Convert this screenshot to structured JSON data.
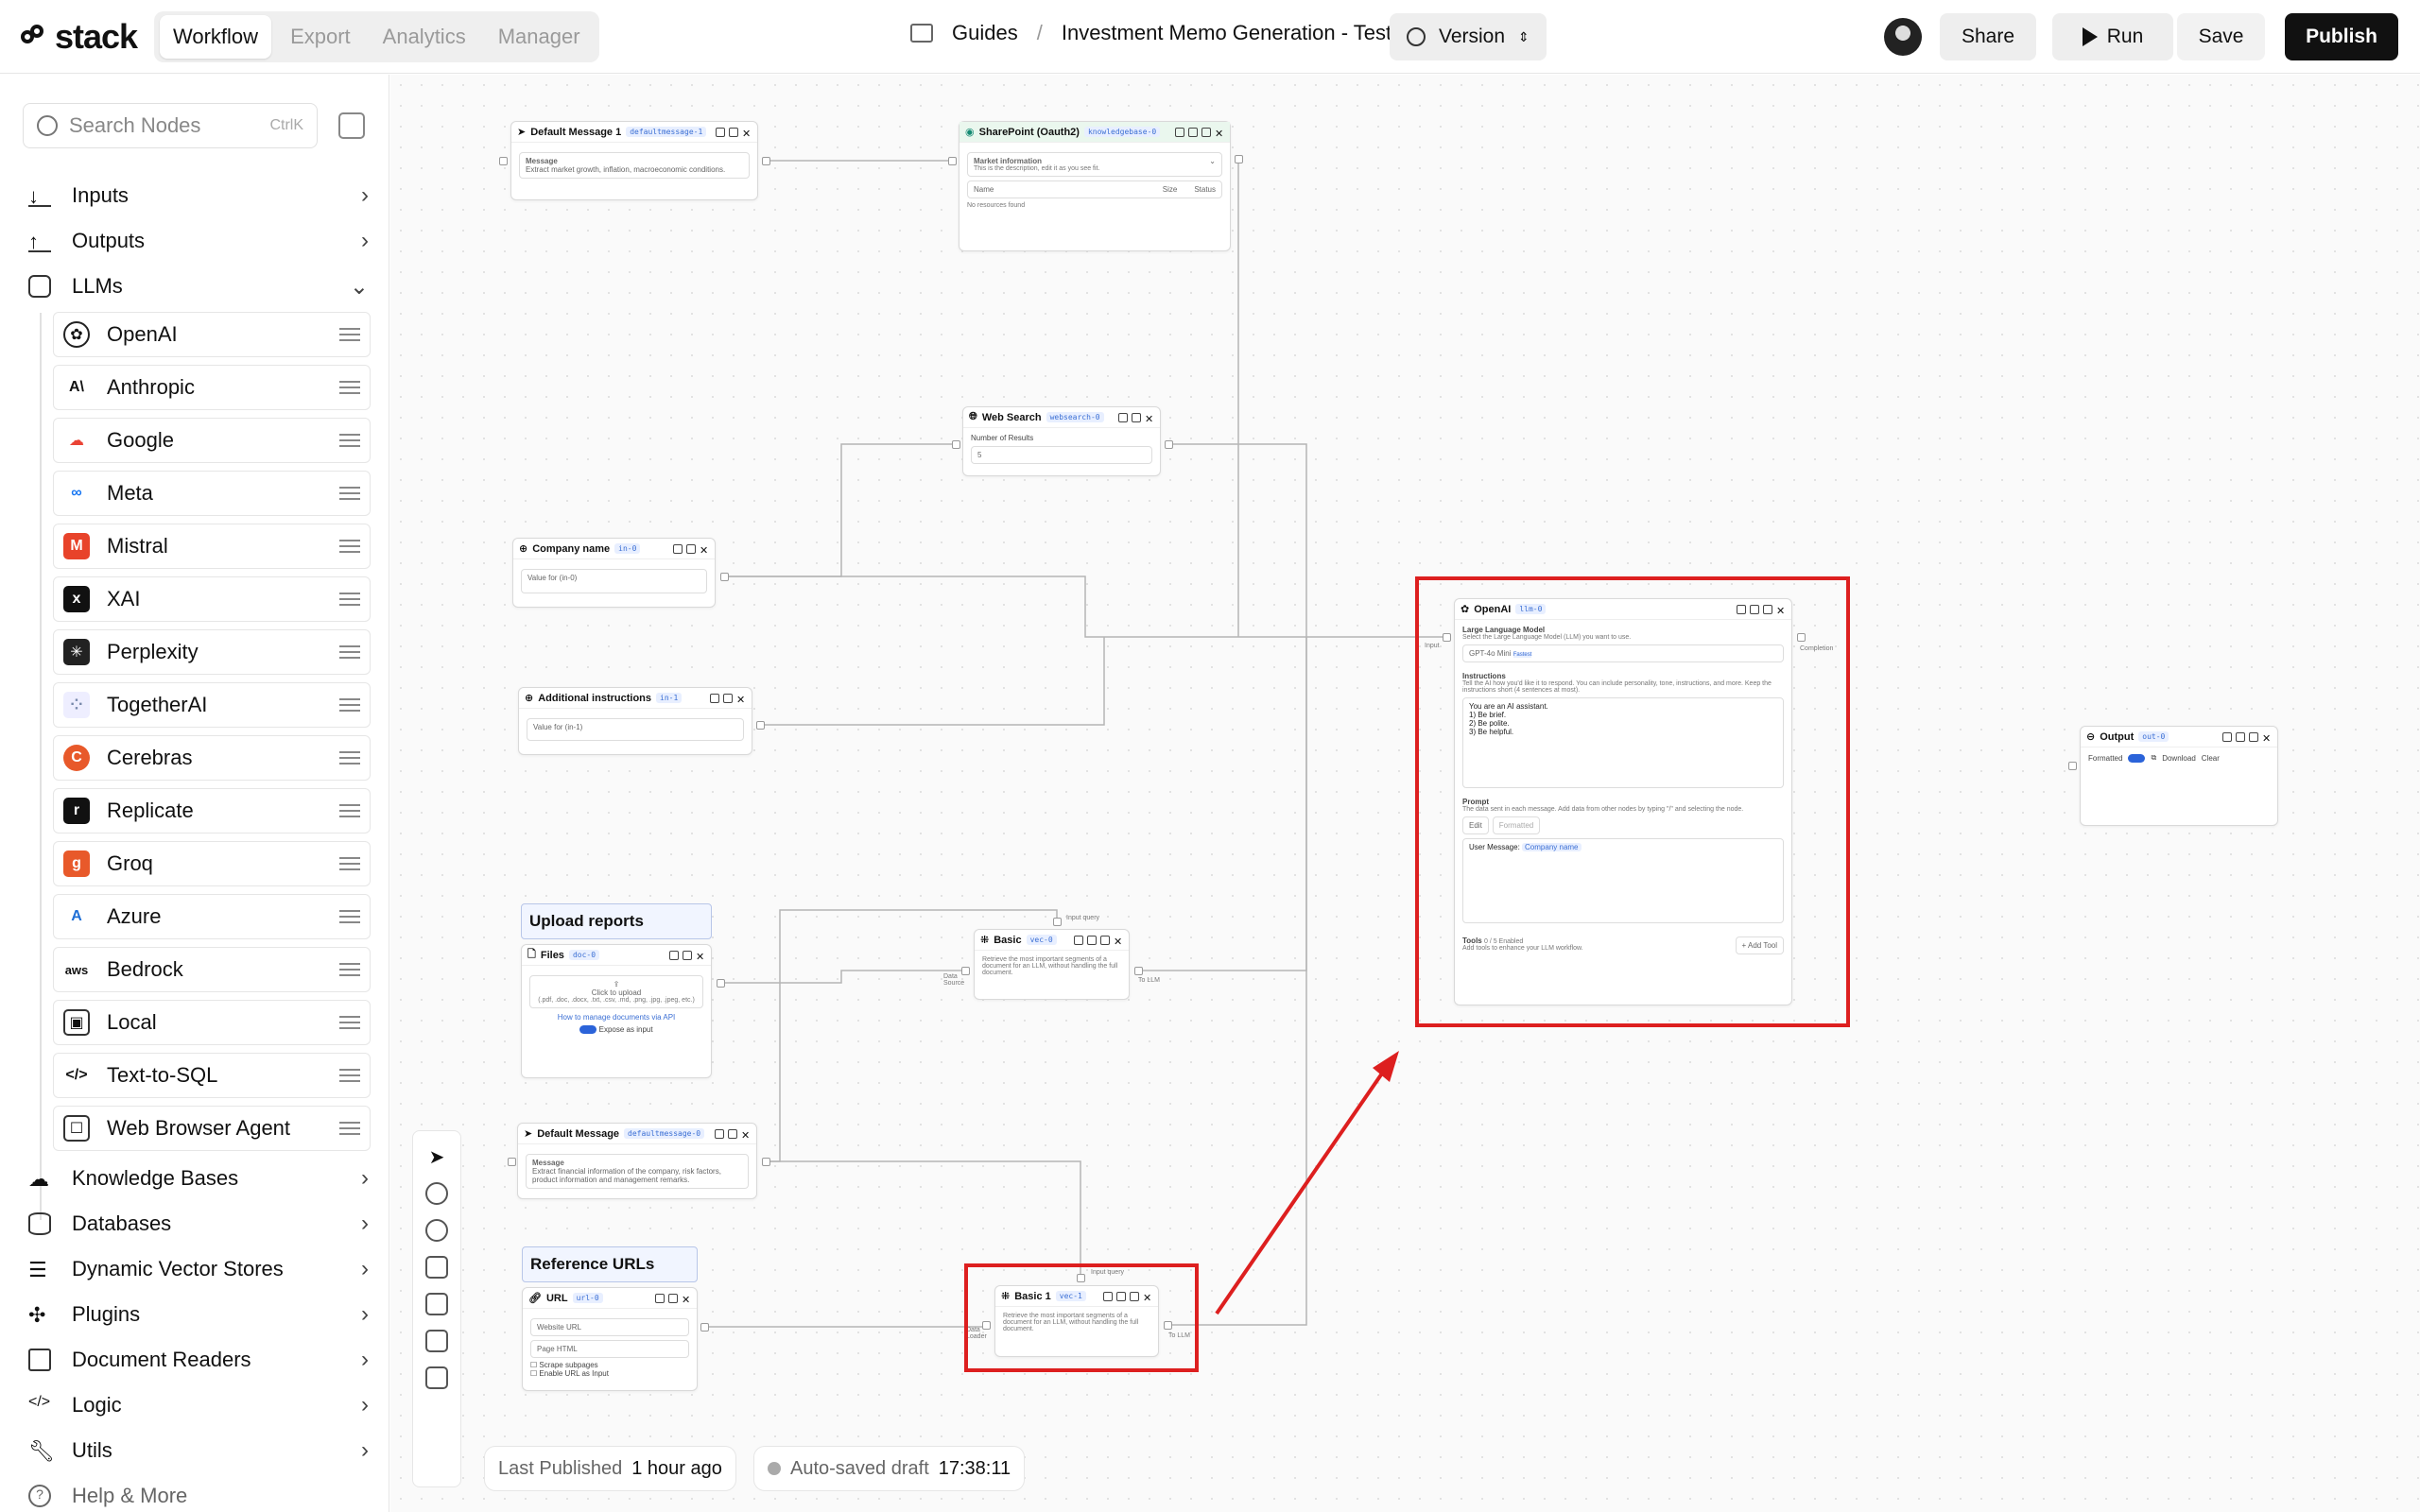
{
  "brand": "stack",
  "tabs": [
    "Workflow",
    "Export",
    "Analytics",
    "Manager"
  ],
  "breadcrumb": {
    "folder": "Guides",
    "page": "Investment Memo Generation - Test"
  },
  "version_label": "Version",
  "header_buttons": {
    "share": "Share",
    "run": "Run",
    "save": "Save",
    "publish": "Publish"
  },
  "sidebar": {
    "search_placeholder": "Search Nodes",
    "search_shortcut": "CtrlK",
    "top_categories": [
      "Inputs",
      "Outputs",
      "LLMs"
    ],
    "llms": [
      "OpenAI",
      "Anthropic",
      "Google",
      "Meta",
      "Mistral",
      "XAI",
      "Perplexity",
      "TogetherAI",
      "Cerebras",
      "Replicate",
      "Groq",
      "Azure",
      "Bedrock",
      "Local",
      "Text-to-SQL",
      "Web Browser Agent"
    ],
    "bottom_categories": [
      "Knowledge Bases",
      "Databases",
      "Dynamic Vector Stores",
      "Plugins",
      "Document Readers",
      "Logic",
      "Utils"
    ],
    "help": "Help & More"
  },
  "nodes": {
    "default_message_1": {
      "title": "Default Message 1",
      "tag": "defaultmessage-1",
      "label": "Message",
      "text": "Extract market growth, inflation, macroeconomic conditions."
    },
    "sharepoint": {
      "title": "SharePoint (Oauth2)",
      "tag": "knowledgebase-0",
      "section": "Market information",
      "desc": "This is the description, edit it as you see fit.",
      "cols": [
        "Name",
        "Size",
        "Status"
      ],
      "empty": "No resources found"
    },
    "web_search": {
      "title": "Web Search",
      "tag": "websearch-0",
      "field": "Number of Results",
      "value": "5"
    },
    "company_name": {
      "title": "Company name",
      "tag": "in-0",
      "placeholder": "Value for (in-0)"
    },
    "additional_instructions": {
      "title": "Additional instructions",
      "tag": "in-1",
      "placeholder": "Value for (in-1)"
    },
    "upload_reports": {
      "label": "Upload reports",
      "title": "Files",
      "tag": "doc-0",
      "upload": "Click to upload",
      "types": "(.pdf, .doc, .docx, .txt, .csv, .md, .png, .jpg, .jpeg, etc.)",
      "link": "How to manage documents via API",
      "toggle": "Expose as input"
    },
    "basic": {
      "title": "Basic",
      "tag": "vec-0",
      "text": "Retrieve the most important segments of a document for an LLM, without handling the full document.",
      "port_top": "Input query",
      "port_left": "Data Source",
      "port_right": "To LLM"
    },
    "default_message": {
      "title": "Default Message",
      "tag": "defaultmessage-0",
      "label": "Message",
      "text": "Extract financial information of the company, risk factors, product information and management remarks."
    },
    "reference_urls": {
      "label": "Reference URLs",
      "title": "URL",
      "tag": "url-0",
      "placeholder": "Website URL",
      "pages": "Page HTML",
      "opt1": "Scrape subpages",
      "opt2": "Enable URL as Input"
    },
    "basic_1": {
      "title": "Basic 1",
      "tag": "vec-1",
      "text": "Retrieve the most important segments of a document for an LLM, without handling the full document.",
      "port_top": "Input query",
      "port_left": "Data Loader",
      "port_right": "To LLM"
    },
    "openai": {
      "title": "OpenAI",
      "tag": "llm-0",
      "model_title": "Large Language Model",
      "model_desc": "Select the Large Language Model (LLM) you want to use.",
      "model": "GPT-4o Mini",
      "model_badge": "Fastest",
      "instr_title": "Instructions",
      "instr_desc": "Tell the AI how you'd like it to respond. You can include personality, tone, instructions, and more. Keep the instructions short (4 sentences at most).",
      "instructions": [
        "You are an AI assistant.",
        "1) Be brief.",
        "2) Be polite.",
        "3) Be helpful."
      ],
      "prompt_title": "Prompt",
      "prompt_desc": "The data sent in each message. Add data from other nodes by typing \"/\" and selecting the node.",
      "prompt_tabs": [
        "Edit",
        "Formatted"
      ],
      "prompt_prefix": "User Message:",
      "prompt_chip": "Company name",
      "tools_title": "Tools",
      "tools_count": "0 / 5 Enabled",
      "tools_desc": "Add tools to enhance your LLM workflow.",
      "add_tool": "+ Add Tool",
      "port_in": "Input",
      "port_out": "Completion"
    },
    "output": {
      "title": "Output",
      "tag": "out-0",
      "mode": "Formatted",
      "download": "Download",
      "clear": "Clear"
    }
  },
  "status": {
    "published_label": "Last Published",
    "published_value": "1 hour ago",
    "draft_label": "Auto-saved draft",
    "draft_value": "17:38:11"
  },
  "colors": {
    "highlight": "#dd1f1f",
    "publish_bg": "#111111"
  }
}
